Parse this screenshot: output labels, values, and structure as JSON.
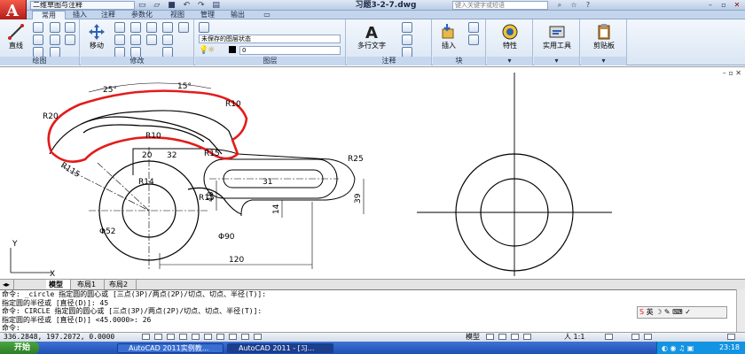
{
  "titlebar": {
    "workspace": "二维草图与注释",
    "doc_title": "习题3-2-7.dwg",
    "search_placeholder": "键入关键字或短语"
  },
  "ribbon": {
    "tabs": [
      "常用",
      "插入",
      "注释",
      "参数化",
      "视图",
      "管理",
      "输出"
    ],
    "active_tab": "常用",
    "panels": {
      "draw": {
        "title": "绘图",
        "line_label": "直线"
      },
      "modify": {
        "title": "修改",
        "move_label": "移动"
      },
      "layers": {
        "title": "图层",
        "state": "未保存的图层状态",
        "current_layer": "0"
      },
      "annotation": {
        "title": "注释",
        "mtext_label": "多行文字"
      },
      "block": {
        "title": "块",
        "insert_label": "插入"
      },
      "properties": {
        "label": "特性"
      },
      "utilities": {
        "label": "实用工具"
      },
      "clipboard": {
        "label": "剪贴板"
      }
    }
  },
  "drawing": {
    "dimensions": {
      "ang1": "25°",
      "ang2": "15°",
      "r10_top": "R10",
      "r20": "R20",
      "r10_mid": "R10",
      "r115": "R115",
      "d20": "20",
      "d32": "32",
      "r15_top": "R15",
      "r25": "R25",
      "r14": "R14",
      "d31": "31",
      "d48": "48",
      "d39": "39",
      "d14": "14",
      "r15_bot": "R15",
      "phi52": "Φ52",
      "phi90": "Φ90",
      "d120": "120"
    },
    "ucs": {
      "x": "X",
      "y": "Y"
    }
  },
  "layout_tabs": [
    "模型",
    "布局1",
    "布局2"
  ],
  "command": {
    "lines": [
      "命令: _circle 指定圆的圆心或 [三点(3P)/两点(2P)/切点、切点、半径(T)]:",
      "指定圆的半径或 [直径(D)]: 45",
      "命令:  CIRCLE 指定圆的圆心或 [三点(3P)/两点(2P)/切点、切点、半径(T)]:",
      "指定圆的半径或 [直径(D)] <45.0000>: 26",
      "命令:"
    ],
    "ime": "英"
  },
  "status": {
    "coords": "336.2848, 197.2072, 0.0000",
    "model": "模型",
    "scale": "人 1:1"
  },
  "taskbar": {
    "start": "开始",
    "tasks": [
      "AutoCAD 2011实例教...",
      "AutoCAD 2011 - [习..."
    ],
    "clock": "23:18"
  },
  "colors": {
    "accent_red": "#e41b1b",
    "ribbon_bg": "#dae6f4",
    "taskbar_blue": "#245edb"
  }
}
